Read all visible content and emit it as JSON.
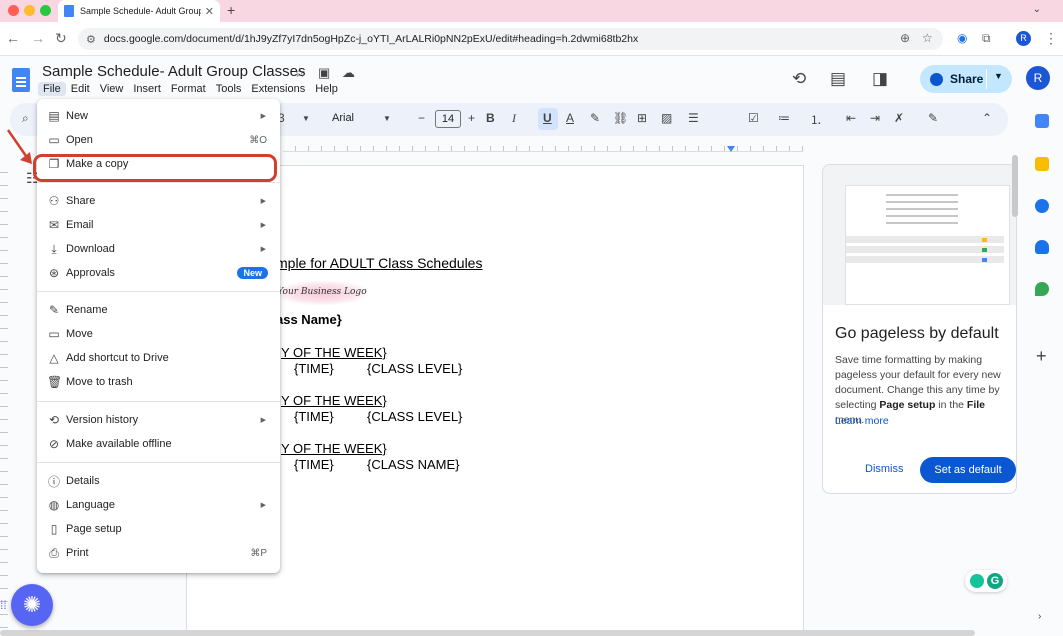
{
  "browser": {
    "tab_title": "Sample Schedule- Adult Group Cl",
    "url": "docs.google.com/document/d/1hJ9yZf7yI7dn5ogHpZc-j_oYTI_ArLALRi0pNN2pExU/edit#heading=h.2dwmi68tb2hx",
    "profile_initial": "R"
  },
  "doc": {
    "title": "Sample Schedule- Adult Group Classes",
    "menus": [
      "File",
      "Edit",
      "View",
      "Insert",
      "Format",
      "Tools",
      "Extensions",
      "Help"
    ],
    "share_label": "Share",
    "avatar_initial": "R"
  },
  "toolbar": {
    "style_partial": "3",
    "font_name": "Arial",
    "font_size": "14"
  },
  "file_menu": {
    "items": [
      {
        "label": "New",
        "icon": "new-doc-icon",
        "submenu": true
      },
      {
        "label": "Open",
        "icon": "folder-icon",
        "shortcut": "⌘O"
      },
      {
        "label": "Make a copy",
        "icon": "copy-icon"
      },
      {
        "label": "Share",
        "icon": "person-add-icon",
        "submenu": true
      },
      {
        "label": "Email",
        "icon": "email-icon",
        "submenu": true
      },
      {
        "label": "Download",
        "icon": "download-icon",
        "submenu": true
      },
      {
        "label": "Approvals",
        "icon": "approvals-icon",
        "badge": "New"
      },
      {
        "label": "Rename",
        "icon": "rename-icon"
      },
      {
        "label": "Move",
        "icon": "move-icon"
      },
      {
        "label": "Add shortcut to Drive",
        "icon": "drive-shortcut-icon"
      },
      {
        "label": "Move to trash",
        "icon": "trash-icon"
      },
      {
        "label": "Version history",
        "icon": "history-icon",
        "submenu": true
      },
      {
        "label": "Make available offline",
        "icon": "offline-icon"
      },
      {
        "label": "Details",
        "icon": "info-icon"
      },
      {
        "label": "Language",
        "icon": "globe-icon",
        "submenu": true
      },
      {
        "label": "Page setup",
        "icon": "page-setup-icon"
      },
      {
        "label": "Print",
        "icon": "print-icon",
        "shortcut": "⌘P"
      }
    ]
  },
  "page": {
    "heading": "mple for ADULT Class Schedules",
    "logo_text": "Your Business Logo",
    "class_name": "ass Name}",
    "rows": [
      {
        "day": "Y OF THE WEEK}",
        "time": "{TIME}",
        "detail": "{CLASS LEVEL}"
      },
      {
        "day": "Y OF THE WEEK}",
        "time": "{TIME}",
        "detail": "{CLASS LEVEL}"
      },
      {
        "day": "Y OF THE WEEK}",
        "time": "{TIME}",
        "detail": "{CLASS NAME}"
      }
    ]
  },
  "side_panel": {
    "title": "Go pageless by default",
    "body_1": "Save time formatting by making pageless your default for every new document. Change this any time by selecting ",
    "body_bold_1": "Page setup",
    "body_2": " in the ",
    "body_bold_2": "File",
    "body_3": " menu.",
    "learn_more": "Learn more",
    "dismiss": "Dismiss",
    "set_default": "Set as default"
  },
  "colors": {
    "accent": "#0b57d0",
    "highlight": "#d1402f",
    "share_bg": "#c2e7ff"
  }
}
